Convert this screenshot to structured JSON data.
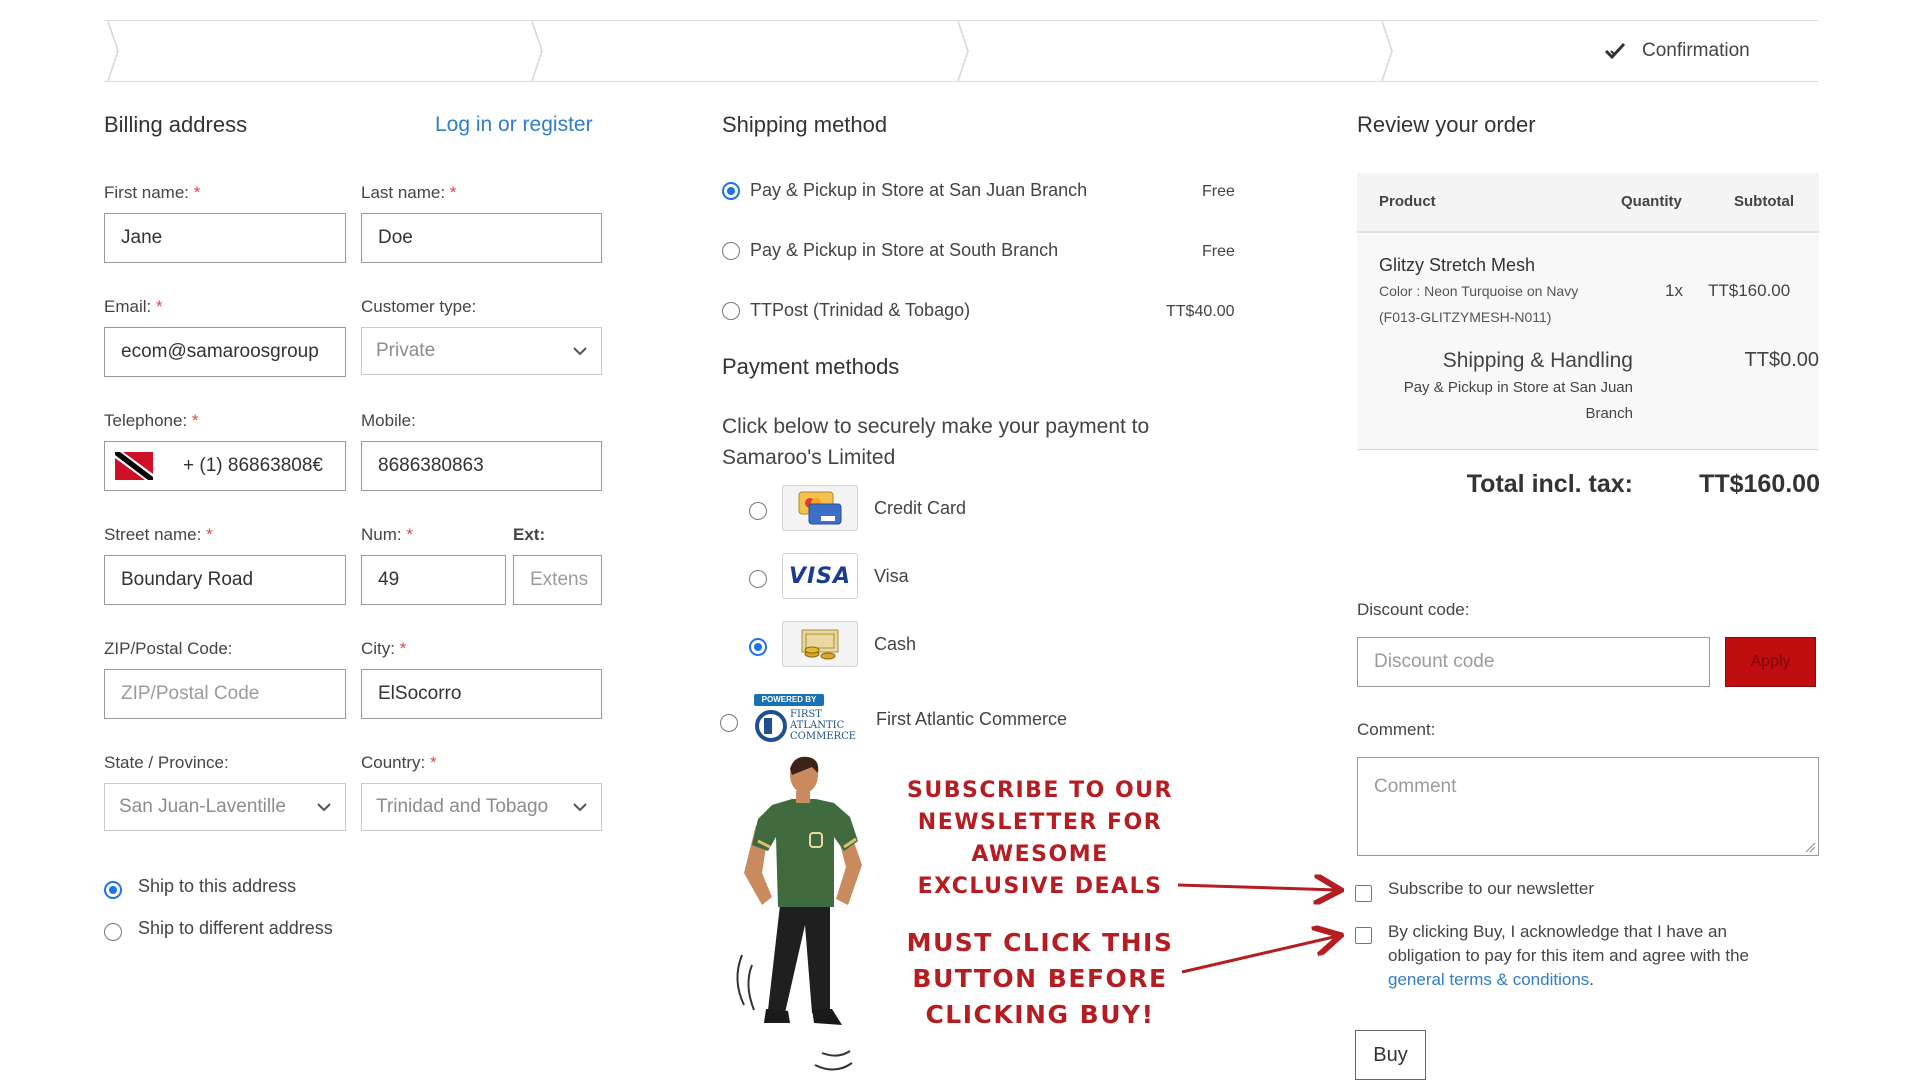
{
  "steps": {
    "confirmation_label": "Confirmation"
  },
  "billing": {
    "title": "Billing address",
    "login_link": "Log in or register",
    "first_name_label": "First name:",
    "first_name_value": "Jane",
    "last_name_label": "Last name:",
    "last_name_value": "Doe",
    "email_label": "Email:",
    "email_value": "ecom@samaroosgroup",
    "customer_type_label": "Customer type:",
    "customer_type_value": "Private",
    "telephone_label": "Telephone:",
    "telephone_value": "+ (1) 86863808€",
    "mobile_label": "Mobile:",
    "mobile_value": "8686380863",
    "street_label": "Street name:",
    "street_value": "Boundary Road",
    "num_label": "Num:",
    "num_value": "49",
    "ext_label": "Ext:",
    "ext_placeholder": "Extens",
    "zip_label": "ZIP/Postal Code:",
    "zip_placeholder": "ZIP/Postal Code",
    "city_label": "City:",
    "city_value": "ElSocorro",
    "state_label": "State / Province:",
    "state_value": "San Juan-Laventille",
    "country_label": "Country:",
    "country_value": "Trinidad and Tobago",
    "ship_same": "Ship to this address",
    "ship_diff": "Ship to different address",
    "required_mark": "*"
  },
  "shipping": {
    "title": "Shipping method",
    "options": [
      {
        "label": "Pay & Pickup in Store at San Juan Branch",
        "price": "Free",
        "selected": true
      },
      {
        "label": "Pay & Pickup in Store at South Branch",
        "price": "Free",
        "selected": false
      },
      {
        "label": "TTPost (Trinidad & Tobago)",
        "price": "TT$40.00",
        "selected": false
      }
    ]
  },
  "payment": {
    "title": "Payment methods",
    "intro_line1": "Click below to securely make your payment to",
    "intro_line2": "Samaroo's Limited",
    "methods": [
      {
        "label": "Credit Card",
        "icon": "credit-card-icon",
        "selected": false
      },
      {
        "label": "Visa",
        "icon": "visa-logo-icon",
        "selected": false
      },
      {
        "label": "Cash",
        "icon": "cash-icon",
        "selected": true
      },
      {
        "label": "First Atlantic Commerce",
        "icon": "first-atlantic-commerce-logo",
        "selected": false
      }
    ],
    "visa_logo_text": "VISA",
    "fac_logo_top": "POWERED BY",
    "fac_logo_line1": "FIRST",
    "fac_logo_line2": "ATLANTIC",
    "fac_logo_line3": "COMMERCE"
  },
  "promo": {
    "newsletter_lines": [
      "SUBSCRIBE TO OUR",
      "NEWSLETTER FOR",
      "AWESOME",
      "EXCLUSIVE DEALS"
    ],
    "buy_lines": [
      "MUST CLICK THIS",
      "BUTTON BEFORE",
      "CLICKING BUY!"
    ]
  },
  "review": {
    "title": "Review your order",
    "col_product": "Product",
    "col_quantity": "Quantity",
    "col_subtotal": "Subtotal",
    "item_name": "Glitzy Stretch Mesh",
    "item_color": "Color : Neon Turquoise on Navy",
    "item_sku": "(F013-GLITZYMESH-N011)",
    "item_qty": "1x",
    "item_subtotal": "TT$160.00",
    "shipping_label": "Shipping & Handling",
    "shipping_desc_line1": "Pay & Pickup in Store at San Juan",
    "shipping_desc_line2": "Branch",
    "shipping_cost": "TT$0.00",
    "total_label": "Total incl. tax:",
    "total_value": "TT$160.00",
    "discount_label": "Discount code:",
    "discount_placeholder": "Discount code",
    "apply_label": "Apply",
    "comment_label": "Comment:",
    "comment_placeholder": "Comment",
    "newsletter_label": "Subscribe to our newsletter",
    "terms_line1": "By clicking Buy, I acknowledge that I have an",
    "terms_line2": "obligation to pay for this item and agree with the",
    "terms_link": "general terms & conditions",
    "terms_end": ".",
    "buy_label": "Buy"
  },
  "colors": {
    "accent": "#1a73e8",
    "link": "#2f7ec9",
    "apply_bg": "#c00d10",
    "promo_text": "#b51d22"
  }
}
